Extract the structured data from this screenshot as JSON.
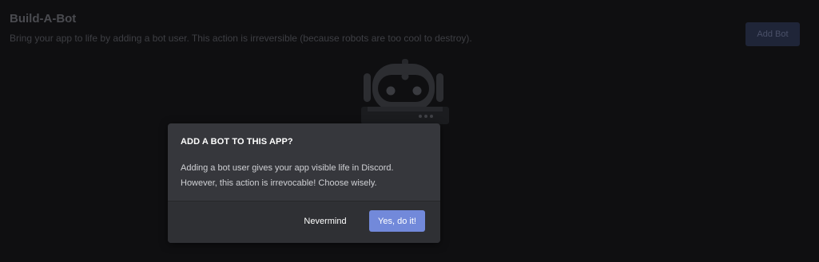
{
  "section": {
    "title": "Build-A-Bot",
    "description": "Bring your app to life by adding a bot user. This action is irreversible (because robots are too cool to destroy).",
    "add_bot_label": "Add Bot"
  },
  "modal": {
    "title": "ADD A BOT TO THIS APP?",
    "body_line1": "Adding a bot user gives your app visible life in Discord.",
    "body_line2": "However, this action is irrevocable! Choose wisely.",
    "cancel_label": "Nevermind",
    "confirm_label": "Yes, do it!"
  },
  "colors": {
    "background": "#0f0f11",
    "modal_bg": "#36373c",
    "modal_footer_bg": "#2f3034",
    "accent": "#7289da"
  },
  "icons": {
    "illustration": "robot-illustration"
  }
}
